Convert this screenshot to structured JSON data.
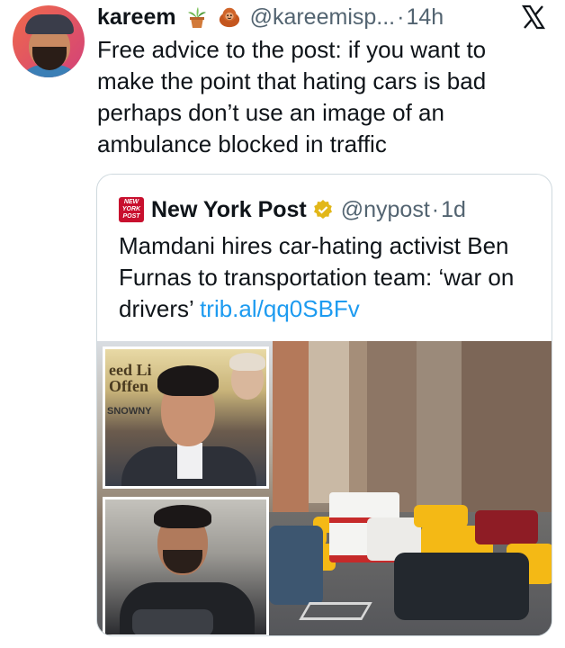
{
  "tweet": {
    "name": "kareem",
    "handle": "@kareemisp...",
    "separator": "·",
    "time": "14h",
    "emoji_icons": [
      "potted-plant-icon",
      "orangutan-icon"
    ],
    "text": "Free advice to the post: if you want to make the point that hating cars is bad perhaps don’t use an image of an ambulance blocked in traffic"
  },
  "quoted": {
    "name": "New York Post",
    "logo_text": [
      "NEW",
      "YORK",
      "POST"
    ],
    "handle": "@nypost",
    "separator": "·",
    "time": "1d",
    "text": "Mamdani hires car-hating activist Ben Furnas to transportation team: ‘war on drivers’ ",
    "link": "trib.al/qq0SBFv"
  },
  "media": {
    "sign_lines": [
      "eed Li",
      "Offen",
      "SNOWNY"
    ]
  },
  "colors": {
    "text": "#0f1419",
    "secondary": "#536471",
    "link": "#1d9bf0",
    "border": "#cfd9de",
    "nypost_red": "#c8102e",
    "verified_gold": "#e2b719"
  }
}
